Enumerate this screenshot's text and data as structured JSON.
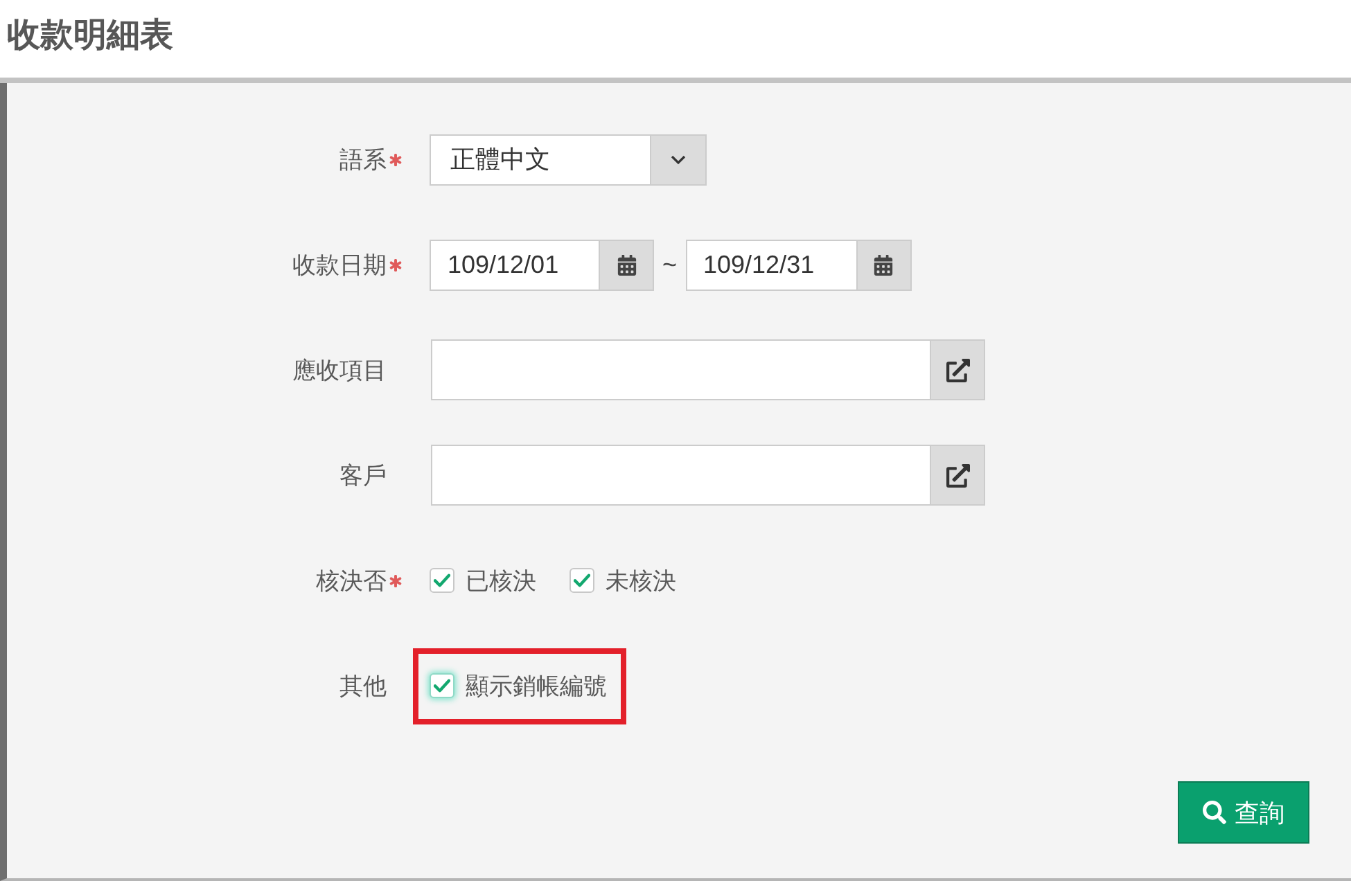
{
  "page": {
    "title": "收款明細表"
  },
  "form": {
    "rows": [
      {
        "kind": "select",
        "label": "語系",
        "required": true,
        "value": "正體中文"
      },
      {
        "kind": "date_range",
        "label": "收款日期",
        "required": true,
        "from": "109/12/01",
        "separator": "~",
        "to": "109/12/31"
      },
      {
        "kind": "lookup",
        "label": "應收項目",
        "required": false
      },
      {
        "kind": "lookup",
        "label": "客戶",
        "required": false
      },
      {
        "kind": "checkboxes",
        "label": "核決否",
        "required": true,
        "options": [
          {
            "label": "已核決",
            "checked": true,
            "focused": false,
            "highlighted": false
          },
          {
            "label": "未核決",
            "checked": true,
            "focused": false,
            "highlighted": false
          }
        ]
      },
      {
        "kind": "checkboxes",
        "label": "其他",
        "required": false,
        "options": [
          {
            "label": "顯示銷帳編號",
            "checked": true,
            "focused": true,
            "highlighted": true
          }
        ]
      }
    ]
  },
  "actions": [
    {
      "kind": "search",
      "label": "查詢"
    }
  ]
}
